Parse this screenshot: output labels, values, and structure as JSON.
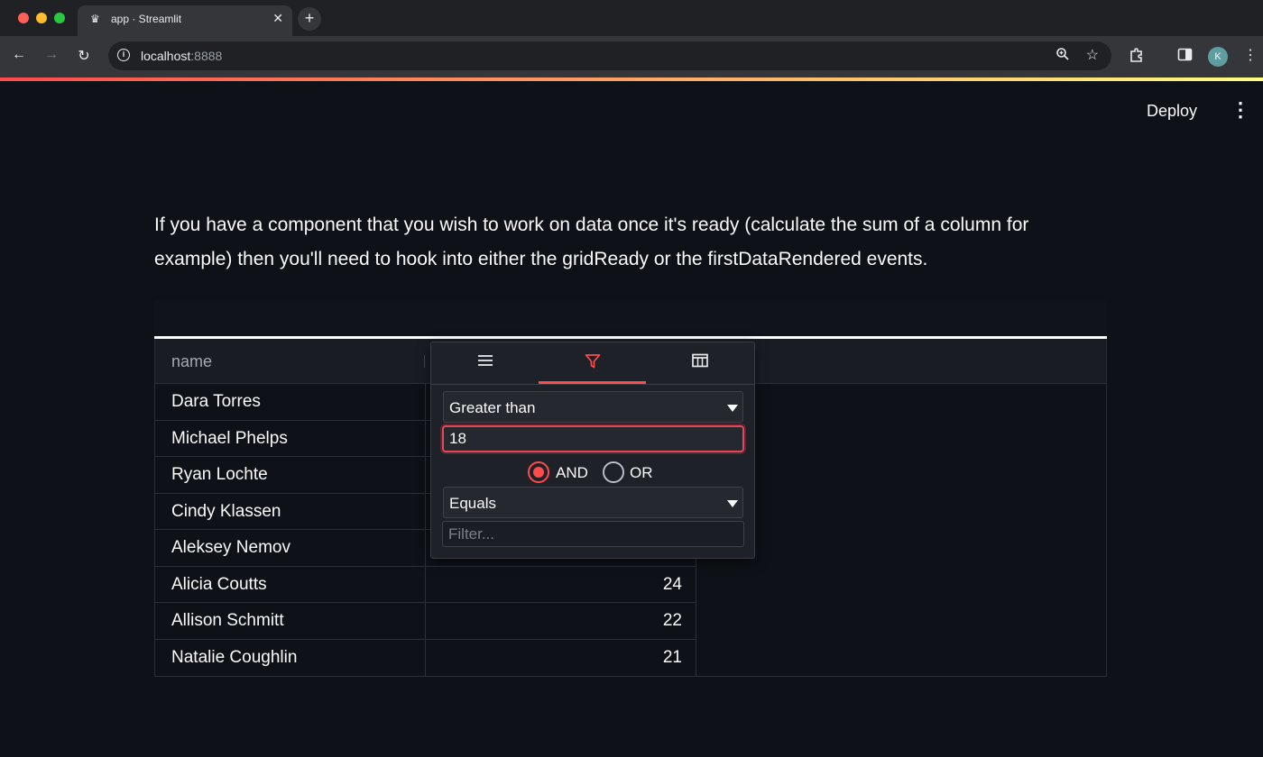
{
  "browser": {
    "tab_title": "app · Streamlit",
    "url_host": "localhost",
    "url_port": ":8888",
    "profile_initial": "K"
  },
  "app": {
    "deploy_label": "Deploy",
    "paragraph": "If you have a component that you wish to work on data once it's ready (calculate the sum of a column for example) then you'll need to hook into either the gridReady or the firstDataRendered events."
  },
  "grid": {
    "columns": [
      "name"
    ],
    "rows": [
      {
        "name": "Dara Torres",
        "age": ""
      },
      {
        "name": "Michael Phelps",
        "age": ""
      },
      {
        "name": "Ryan Lochte",
        "age": ""
      },
      {
        "name": "Cindy Klassen",
        "age": ""
      },
      {
        "name": "Aleksey Nemov",
        "age": ""
      },
      {
        "name": "Alicia Coutts",
        "age": "24"
      },
      {
        "name": "Allison Schmitt",
        "age": "22"
      },
      {
        "name": "Natalie Coughlin",
        "age": "21"
      }
    ]
  },
  "filter_popup": {
    "condition1_type": "Greater than",
    "condition1_value": "18",
    "operator_and": "AND",
    "operator_or": "OR",
    "condition2_type": "Equals",
    "condition2_placeholder": "Filter..."
  },
  "colors": {
    "accent": "#ff4b4b",
    "background": "#0e1117"
  }
}
